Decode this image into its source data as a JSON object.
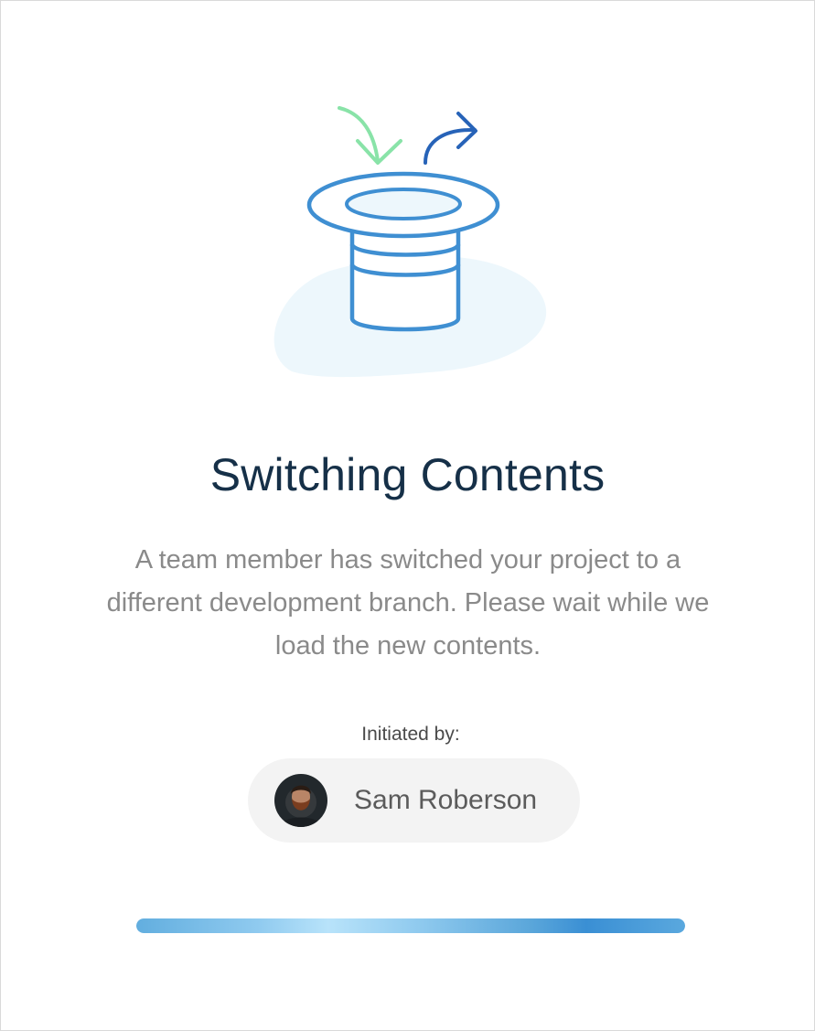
{
  "dialog": {
    "title": "Switching Contents",
    "description": "A team member has switched your project to a different development branch. Please wait while we load the new contents.",
    "initiated_label": "Initiated by:",
    "user_name": "Sam Roberson",
    "illustration_icon": "magic-hat-switch-icon",
    "avatar_icon": "user-avatar-photo"
  },
  "progress": {
    "value": 1.0
  },
  "colors": {
    "title": "#163048",
    "description": "#8a8a8a",
    "label": "#4a4a4a",
    "chip_background": "#f3f3f3",
    "hat_stroke": "#3f8fd2",
    "hat_fill": "#edf7fc",
    "arrow_in": "#89e3a8",
    "arrow_out": "#2763b8",
    "progress_accent": "#3a8fd4"
  }
}
